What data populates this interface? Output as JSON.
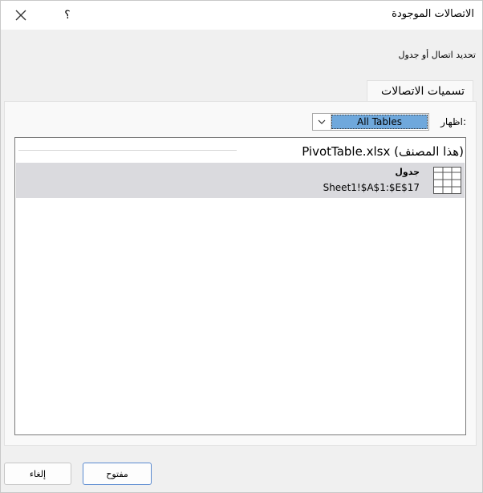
{
  "window": {
    "title": "الاتصالات الموجودة",
    "help": "؟",
    "close_icon": "close-icon"
  },
  "subtitle": "تحديد اتصال أو جدول",
  "tabs": [
    {
      "label": "تسميات الاتصالات"
    }
  ],
  "filter": {
    "label": "اظهار:",
    "selected": "All Tables"
  },
  "list": {
    "group_header": "PivotTable.xlsx (هذا المصنف)",
    "items": [
      {
        "name": "جدول",
        "description": "Sheet1!$A$1:$E$17",
        "icon": "table-icon",
        "selected": true
      }
    ]
  },
  "buttons": {
    "open": "مفتوح",
    "cancel": "إلغاء"
  },
  "colors": {
    "selection": "#dadade",
    "dropdown_highlight": "#6fa8dc"
  }
}
